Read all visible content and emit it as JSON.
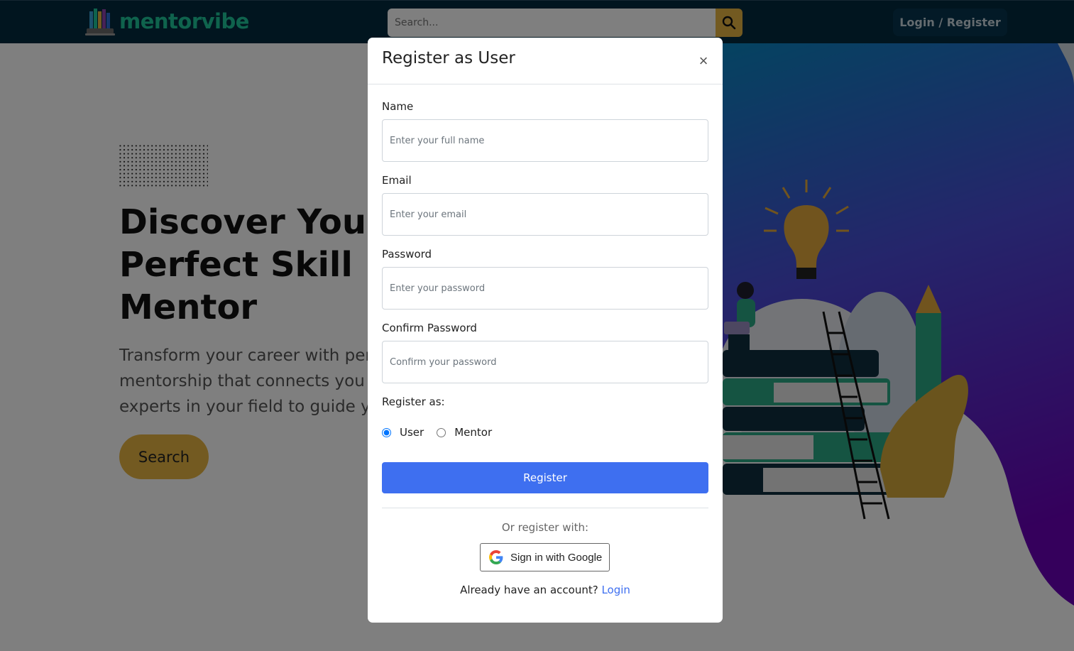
{
  "navbar": {
    "logo_text": "mentorvibe",
    "search_placeholder": "Search...",
    "login_register_label": "Login / Register"
  },
  "hero": {
    "title": "Discover Your Perfect Skill Mentor",
    "subtitle_lines": [
      "Transform your career with personalized",
      "mentorship that connects you with",
      "experts in your field to guide your"
    ],
    "search_button": "Search"
  },
  "modal": {
    "title": "Register as User",
    "close_glyph": "×",
    "fields": {
      "name": {
        "label": "Name",
        "placeholder": "Enter your full name"
      },
      "email": {
        "label": "Email",
        "placeholder": "Enter your email"
      },
      "password": {
        "label": "Password",
        "placeholder": "Enter your password"
      },
      "confirm": {
        "label": "Confirm Password",
        "placeholder": "Confirm your password"
      }
    },
    "register_as_label": "Register as:",
    "roles": {
      "user": "User",
      "mentor": "Mentor",
      "selected": "User"
    },
    "register_button": "Register",
    "or_text": "Or register with:",
    "google_button": "Sign in with Google",
    "account_prompt": "Already have an account?",
    "login_link": "Login"
  },
  "colors": {
    "navbar_bg": "#032a3e",
    "brand_green": "#1fc79a",
    "accent_gold": "#e7b443",
    "primary_blue": "#3e6ff0"
  }
}
